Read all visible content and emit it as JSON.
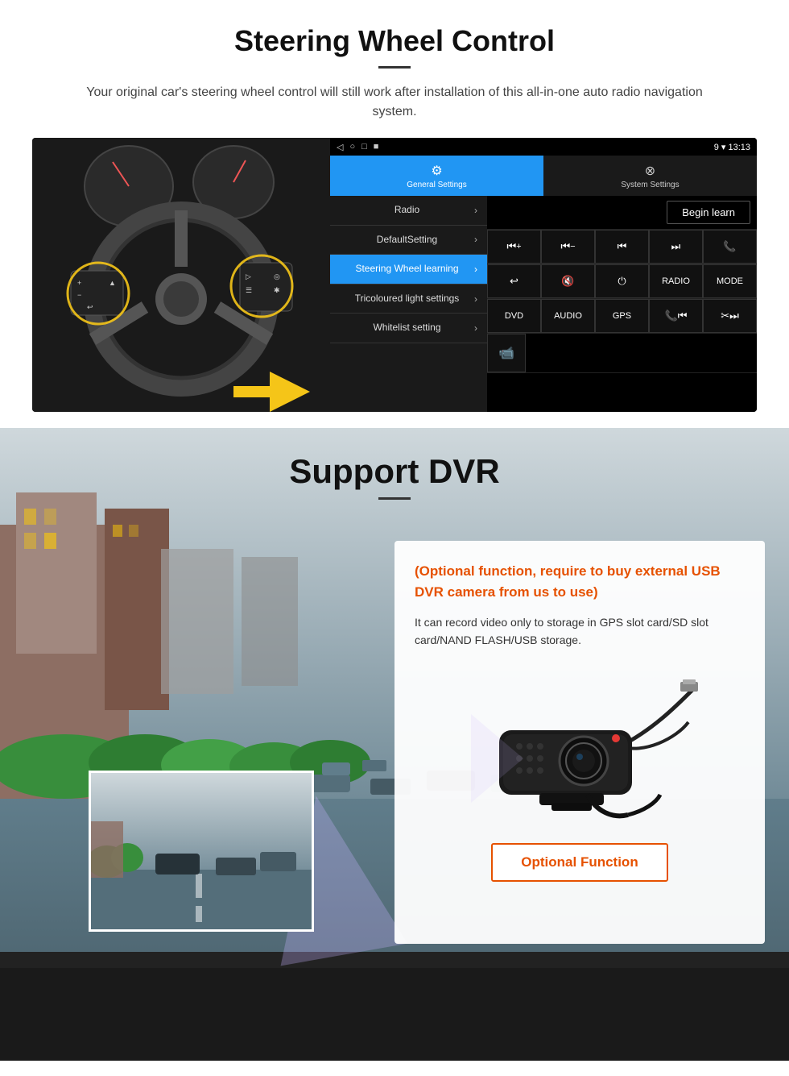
{
  "steering_section": {
    "title": "Steering Wheel Control",
    "subtitle": "Your original car's steering wheel control will still work after installation of this all-in-one auto radio navigation system.",
    "status_bar": {
      "time": "13:13",
      "icons": [
        "◁",
        "○",
        "□",
        "■"
      ]
    },
    "tabs": {
      "general": {
        "label": "General Settings",
        "icon": "⚙"
      },
      "system": {
        "label": "System Settings",
        "icon": "⊗"
      }
    },
    "menu_items": [
      {
        "label": "Radio",
        "active": false
      },
      {
        "label": "DefaultSetting",
        "active": false
      },
      {
        "label": "Steering Wheel learning",
        "active": true
      },
      {
        "label": "Tricoloured light settings",
        "active": false
      },
      {
        "label": "Whitelist setting",
        "active": false
      }
    ],
    "begin_learn": "Begin learn",
    "control_buttons_row1": [
      "⏮+",
      "⏮−",
      "⏮⏮",
      "⏭⏭",
      "☎"
    ],
    "control_buttons_row2": [
      "↩",
      "🔇×",
      "⏻",
      "RADIO",
      "MODE"
    ],
    "control_buttons_row3": [
      "DVD",
      "AUDIO",
      "GPS",
      "📞⏮",
      "✂⏭"
    ],
    "control_buttons_row4_icon": "📹"
  },
  "dvr_section": {
    "title": "Support DVR",
    "optional_text": "(Optional function, require to buy external USB DVR camera from us to use)",
    "description": "It can record video only to storage in GPS slot card/SD slot card/NAND FLASH/USB storage.",
    "optional_button": "Optional Function"
  }
}
